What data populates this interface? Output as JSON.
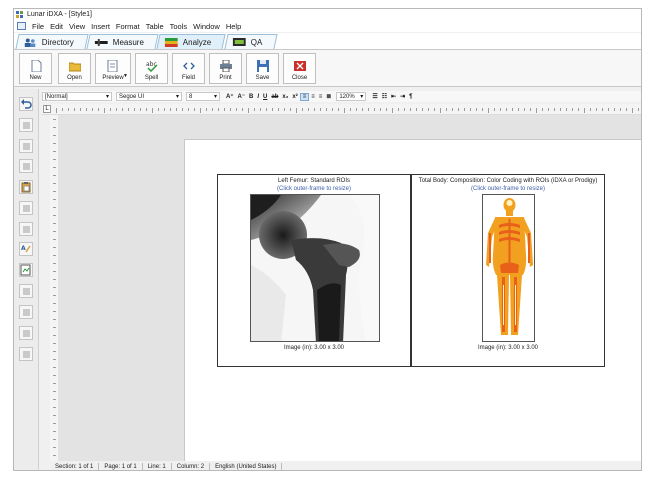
{
  "window": {
    "title": "Lunar iDXA - [Style1]"
  },
  "menu": [
    "File",
    "Edit",
    "View",
    "Insert",
    "Format",
    "Table",
    "Tools",
    "Window",
    "Help"
  ],
  "tabs": [
    {
      "label": "Directory",
      "icon": "people-icon"
    },
    {
      "label": "Measure",
      "icon": "ruler-icon"
    },
    {
      "label": "Analyze",
      "icon": "color-bars-icon"
    },
    {
      "label": "QA",
      "icon": "monitor-icon"
    }
  ],
  "toolbar": {
    "new": "New",
    "open": "Open",
    "preview": "Preview",
    "spell": "Spell",
    "field": "Field",
    "print": "Print",
    "save": "Save",
    "close": "Close"
  },
  "format_bar": {
    "style": "[Normal]",
    "font": "Segoe UI",
    "size": "8",
    "zoom": "120%"
  },
  "document": {
    "frames": [
      {
        "title": "Left Femur: Standard ROIs",
        "hint": "(Click outer-frame to resize)",
        "caption": "Image (in): 3.00 x 3.00",
        "image": "femur-xray"
      },
      {
        "title": "Total Body: Composition: Color Coding with ROIs (iDXA or Prodigy)",
        "hint": "(Click outer-frame to resize)",
        "caption": "Image (in): 3.00 x 3.00",
        "image": "total-body-composition"
      }
    ]
  },
  "status": {
    "section": "Section: 1 of 1",
    "page": "Page: 1 of 1",
    "line": "Line: 1",
    "column": "Column: 2",
    "language": "English (United States)"
  }
}
